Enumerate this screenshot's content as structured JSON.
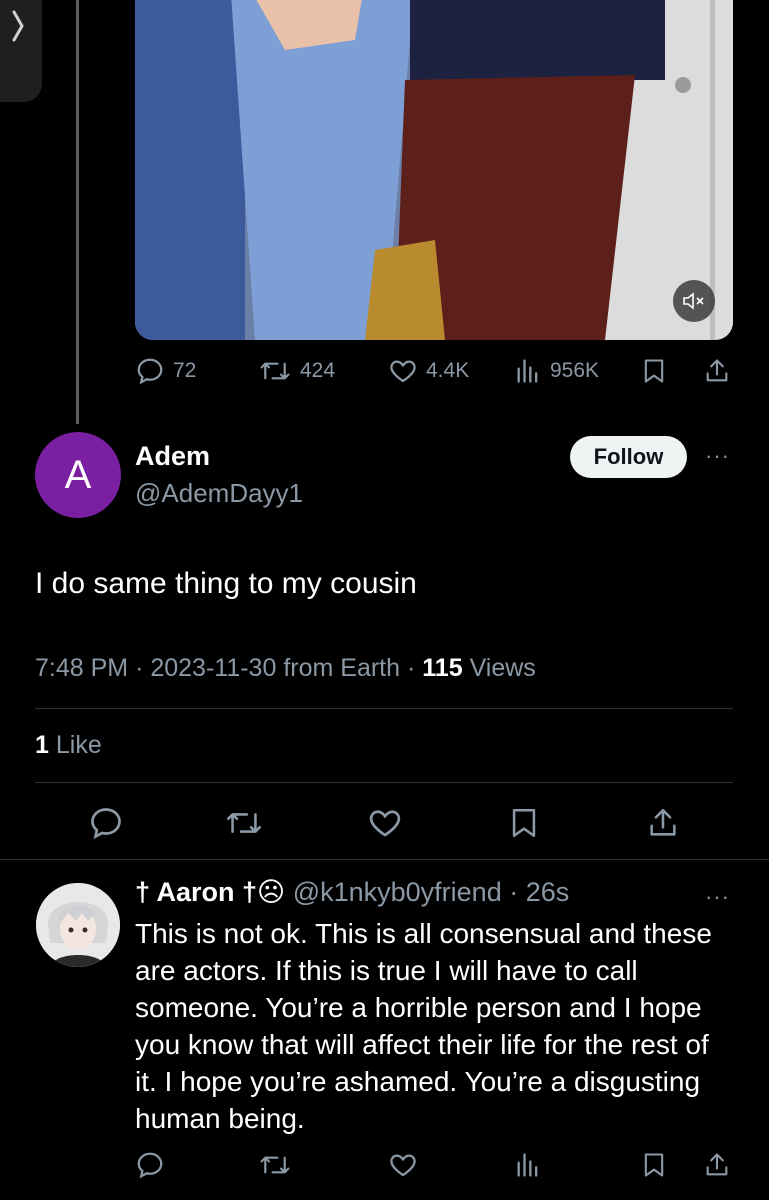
{
  "tweet": {
    "stats": {
      "replies": "72",
      "reposts": "424",
      "likes": "4.4K",
      "views": "956K"
    }
  },
  "reply": {
    "avatar_letter": "A",
    "name": "Adem",
    "handle": "@AdemDayy1",
    "follow_label": "Follow",
    "more_label": "···",
    "text": "I do same thing to my cousin",
    "time": "7:48 PM",
    "date": "2023-11-30",
    "source": "from Earth",
    "views_count": "115",
    "views_label": "Views",
    "likes_count": "1",
    "likes_label": "Like"
  },
  "comment": {
    "name": "† Aaron †☹",
    "handle": "@k1nkyb0yfriend",
    "age": "26s",
    "more_label": "···",
    "text": "This is not ok. This is all consensual and these are actors. If this is true I will have to call someone. You’re a horrible person and I hope you know that will affect their life for the rest of it. I hope you’re ashamed. You’re a disgusting human being."
  },
  "icons": [
    "chevron-right-icon",
    "mute-icon",
    "reply-icon",
    "repost-icon",
    "like-icon",
    "views-icon",
    "bookmark-icon",
    "share-icon",
    "more-icon"
  ],
  "colors": {
    "background": "#000000",
    "text": "#e7e9ea",
    "secondary": "#8b98a5",
    "avatar_purple": "#7b1fa2",
    "follow_bg": "#eff3f4",
    "divider": "#2f3336"
  }
}
